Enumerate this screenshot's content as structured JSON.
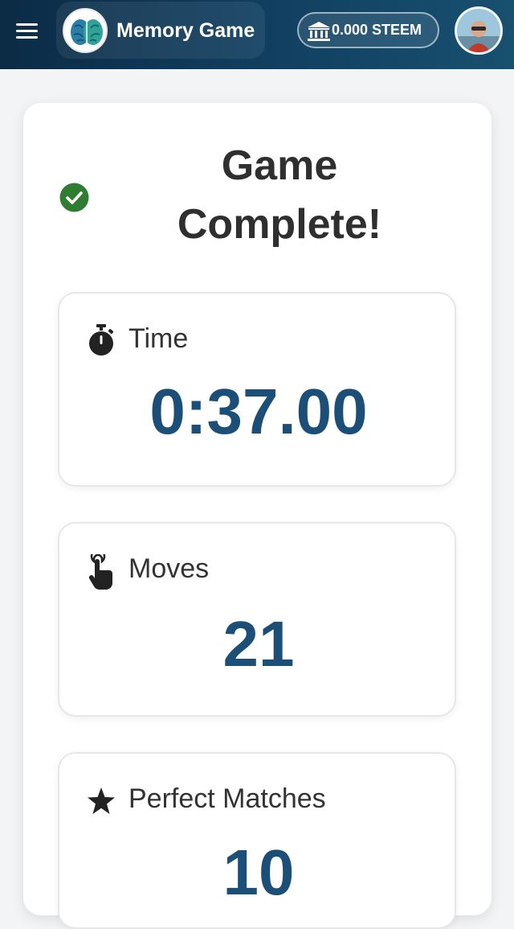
{
  "header": {
    "app_title": "Memory Game",
    "wallet_balance": "0.000 STEEM",
    "colors": {
      "bar_dark": "#0c2b45",
      "bar_light": "#18506f"
    }
  },
  "result": {
    "title": "Game Complete!",
    "status_icon": "check-circle-icon",
    "status_color": "#2e7d32",
    "value_color": "#1b4f78"
  },
  "stats": [
    {
      "icon": "stopwatch-icon",
      "label": "Time",
      "value": "0:37.00"
    },
    {
      "icon": "pointer-hand-icon",
      "label": "Moves",
      "value": "21"
    },
    {
      "icon": "star-icon",
      "label": "Perfect Matches",
      "value": "10"
    }
  ]
}
